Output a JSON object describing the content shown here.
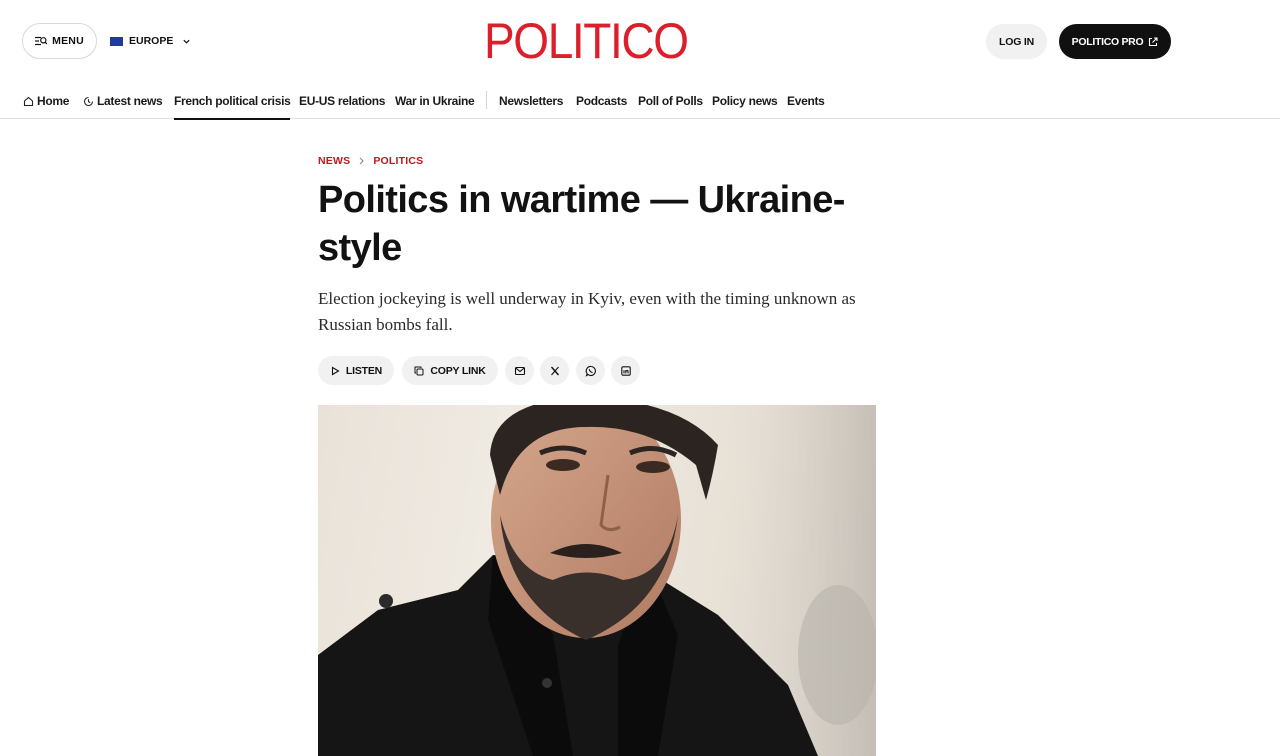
{
  "header": {
    "menu_label": "MENU",
    "region_label": "EUROPE",
    "logo_text": "POLITICO",
    "login_label": "LOG IN",
    "pro_label": "POLITICO PRO"
  },
  "nav": {
    "items": [
      {
        "label": "Home",
        "icon": "home-icon"
      },
      {
        "label": "Latest news",
        "icon": "clock-icon"
      },
      {
        "label": "French political crisis"
      },
      {
        "label": "EU-US relations"
      },
      {
        "label": "War in Ukraine"
      },
      {
        "label": "Newsletters"
      },
      {
        "label": "Podcasts"
      },
      {
        "label": "Poll of Polls"
      },
      {
        "label": "Policy news"
      },
      {
        "label": "Events"
      }
    ],
    "active_index": 2
  },
  "article": {
    "breadcrumb": [
      "NEWS",
      "POLITICS"
    ],
    "headline": "Politics in wartime — Ukraine-style",
    "dek": "Election jockeying is well underway in Kyiv, even with the timing unknown as Russian bombs fall.",
    "actions": {
      "listen_label": "LISTEN",
      "copy_link_label": "COPY LINK",
      "share_icons": [
        "mail-icon",
        "x-icon",
        "whatsapp-icon",
        "linkedin-icon"
      ]
    }
  },
  "colors": {
    "brand_red": "#dc1f2b",
    "breadcrumb_red": "#c4161c",
    "pro_button_bg": "#101010",
    "pill_bg": "#f1f1f1"
  }
}
